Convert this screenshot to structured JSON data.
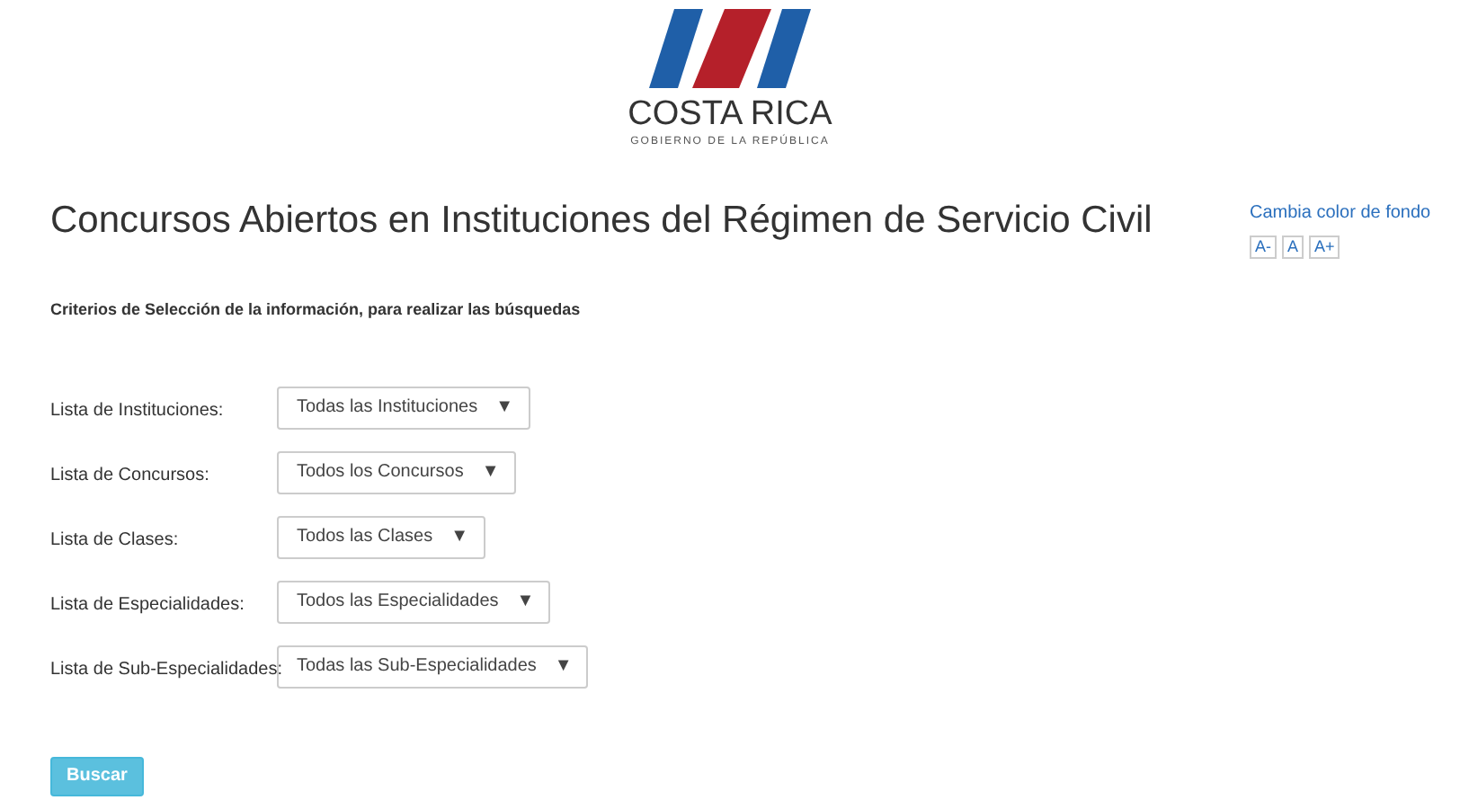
{
  "logo": {
    "name": "COSTA RICA",
    "subtitle": "GOBIERNO DE LA REPÚBLICA"
  },
  "title": "Concursos Abiertos en Instituciones del Régimen de Servicio Civil",
  "accessibility": {
    "link": "Cambia color de fondo",
    "font_buttons": [
      "A-",
      "A",
      "A+"
    ]
  },
  "criteria_heading": "Criterios de Selección de la información, para realizar las búsquedas",
  "filters": [
    {
      "label": "Lista de Instituciones:",
      "value": "Todas las Instituciones",
      "arrow": "▼"
    },
    {
      "label": "Lista de Concursos:",
      "value": "Todos los Concursos",
      "arrow": "▼"
    },
    {
      "label": "Lista de Clases:",
      "value": "Todos las Clases",
      "arrow": "▼"
    },
    {
      "label": "Lista de Especialidades:",
      "value": "Todos las Especialidades",
      "arrow": "▼"
    },
    {
      "label": "Lista de Sub-Especialidades:",
      "value": "Todas las Sub-Especialidades",
      "arrow": "▼"
    }
  ],
  "search_button": "Buscar"
}
